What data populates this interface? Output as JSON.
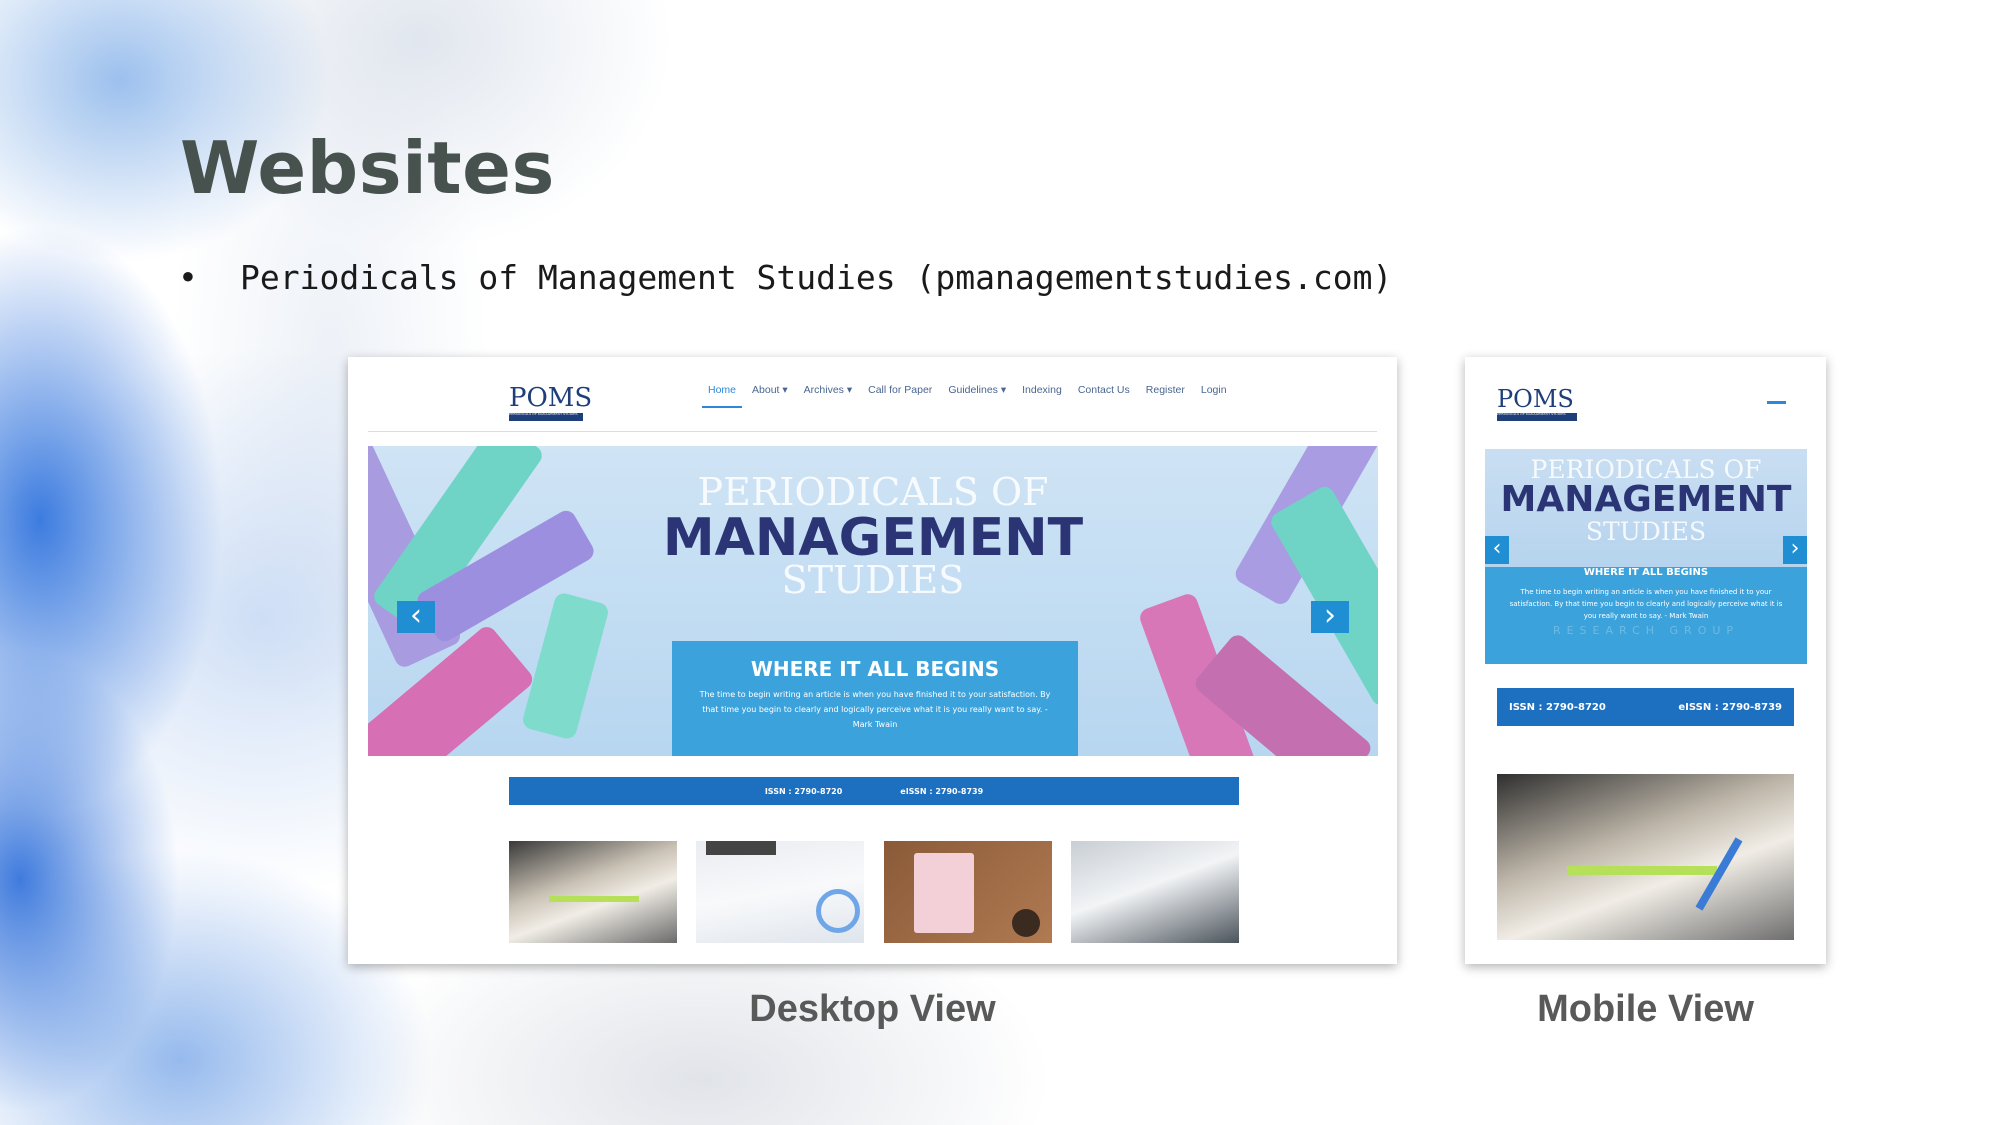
{
  "slide": {
    "title": "Websites",
    "bullet": "Periodicals of Management Studies (pmanagementstudies.com)",
    "bullet_marker": "•"
  },
  "desktop": {
    "caption": "Desktop View",
    "logo": "POMS",
    "logo_tagline": "PERIODICALS OF MANAGEMENT STUDIES",
    "nav": [
      "Home",
      "About ▾",
      "Archives ▾",
      "Call for Paper",
      "Guidelines ▾",
      "Indexing",
      "Contact Us",
      "Register",
      "Login"
    ],
    "banner_line1": "PERIODICALS OF",
    "banner_line2": "MANAGEMENT",
    "banner_line3": "STUDIES",
    "box_heading": "WHERE IT ALL BEGINS",
    "box_text": "The time to begin writing an article is when you have finished it to your satisfaction. By that time you begin to clearly and logically perceive what it is you really want to say. - Mark Twain",
    "issn": "ISSN : 2790-8720",
    "eissn": "eISSN : 2790-8739",
    "arrow_left": "‹",
    "arrow_right": "›"
  },
  "mobile": {
    "caption": "Mobile View",
    "logo": "POMS",
    "logo_tagline": "PERIODICALS OF MANAGEMENT STUDIES",
    "banner_line1": "PERIODICALS OF",
    "banner_line2": "MANAGEMENT",
    "banner_line3": "STUDIES",
    "box_heading": "WHERE IT ALL BEGINS",
    "box_text": "The time to begin writing an article is when you have finished it to your satisfaction. By that time you begin to clearly and logically perceive what it is you really want to say. - Mark Twain",
    "faded_text": "RESEARCH GROUP",
    "issn": "ISSN : 2790-8720",
    "eissn": "eISSN : 2790-8739",
    "arrow_left": "‹",
    "arrow_right": "›"
  },
  "colors": {
    "title": "#47524e",
    "accent_blue": "#1d6fbf",
    "box_blue": "#3ca2dc",
    "banner_navy": "#2b3474"
  }
}
